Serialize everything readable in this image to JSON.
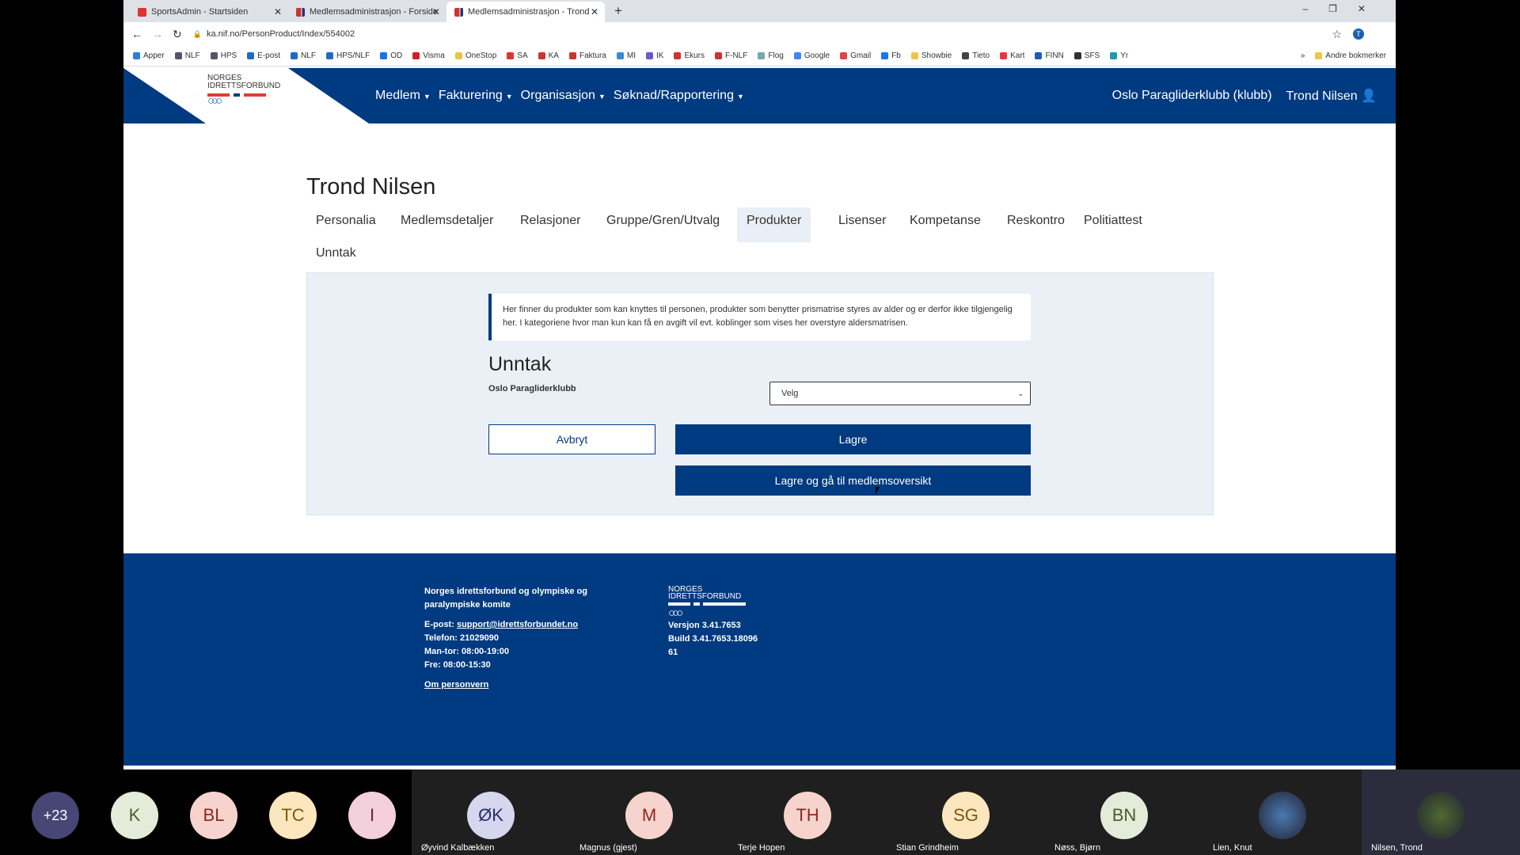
{
  "browser": {
    "tabs": [
      {
        "title": "SportsAdmin - Startsiden"
      },
      {
        "title": "Medlemsadministrasjon - Forside"
      },
      {
        "title": "Medlemsadministrasjon - Trond"
      }
    ],
    "url": "ka.nif.no/PersonProduct/Index/554002",
    "bookmarks": [
      "Apper",
      "NLF",
      "HPS",
      "E-post",
      "NLF",
      "HPS/NLF",
      "OD",
      "Visma",
      "OneStop",
      "SA",
      "KA",
      "Faktura",
      "MI",
      "IK",
      "Ekurs",
      "F-NLF",
      "Flog",
      "Google",
      "Gmail",
      "Fb",
      "Showbie",
      "Tieto",
      "Kart",
      "FINN",
      "SFS",
      "Yr"
    ],
    "more": "»",
    "other_bookmarks": "Andre bokmerker",
    "profile_initial": "T"
  },
  "header": {
    "logo_line1": "NORGES",
    "logo_line2": "IDRETTSFORBUND",
    "nav": [
      "Medlem",
      "Fakturering",
      "Organisasjon",
      "Søknad/Rapportering"
    ],
    "club": "Oslo Paragliderklubb (klubb)",
    "user": "Trond Nilsen"
  },
  "page": {
    "title": "Trond Nilsen",
    "tabs": [
      "Personalia",
      "Medlemsdetaljer",
      "Relasjoner",
      "Gruppe/Gren/Utvalg",
      "Produkter",
      "Lisenser",
      "Kompetanse",
      "Reskontro",
      "Politiattest",
      "Unntak"
    ],
    "active_tab": "Produkter",
    "info": "Her finner du produkter som kan knyttes til personen, produkter som benytter prismatrise styres av alder og er derfor ikke tilgjengelig her. I kategoriene hvor man kun kan få en avgift vil evt. koblinger som vises her overstyre aldersmatrisen.",
    "section_title": "Unntak",
    "club_label": "Oslo Paragliderklubb",
    "select_value": "Velg",
    "cancel": "Avbryt",
    "save": "Lagre",
    "save_go": "Lagre og gå til medlemsoversikt"
  },
  "footer": {
    "org": "Norges idrettsforbund og olympiske og paralympiske komite",
    "email_label": "E-post: ",
    "email": "support@idrettsforbundet.no",
    "phone": "Telefon: 21029090",
    "hours1": "Man-tor: 08:00-19:00",
    "hours2": "Fre: 08:00-15:30",
    "privacy": "Om personvern",
    "logo_line1": "NORGES",
    "logo_line2": "IDRETTSFORBUND",
    "version": "Versjon 3.41.7653",
    "build": "Build 3.41.7653.18096",
    "build2": "61"
  },
  "participants": {
    "overflow": "+23",
    "small": [
      {
        "i": "K",
        "bg": "#e4ecd9",
        "fg": "#4a5a30"
      },
      {
        "i": "BL",
        "bg": "#f7d3cd",
        "fg": "#8a2a20"
      },
      {
        "i": "TC",
        "bg": "#fbe6bd",
        "fg": "#7a5a10"
      },
      {
        "i": "I",
        "bg": "#f4cfdc",
        "fg": "#7a1a3a"
      }
    ],
    "tiles": [
      {
        "i": "ØK",
        "name": "Øyvind Kalbækken",
        "bg": "#d6d7ef",
        "fg": "#2a2c6a"
      },
      {
        "i": "M",
        "name": "Magnus (gjest)",
        "bg": "#f7d3cd",
        "fg": "#8a2a20"
      },
      {
        "i": "TH",
        "name": "Terje Hopen",
        "bg": "#f7d3cd",
        "fg": "#8a2a20"
      },
      {
        "i": "SG",
        "name": "Stian Grindheim",
        "bg": "#fbe6bd",
        "fg": "#7a5a10"
      },
      {
        "i": "BN",
        "name": "Nøss, Bjørn",
        "bg": "#e4ecd9",
        "fg": "#4a5a30"
      },
      {
        "i": "",
        "name": "Lien, Knut",
        "bg": "#4a7ab0",
        "fg": "#fff"
      },
      {
        "i": "",
        "name": "Nilsen, Trond",
        "bg": "#4e6a2e",
        "fg": "#fff"
      }
    ]
  }
}
